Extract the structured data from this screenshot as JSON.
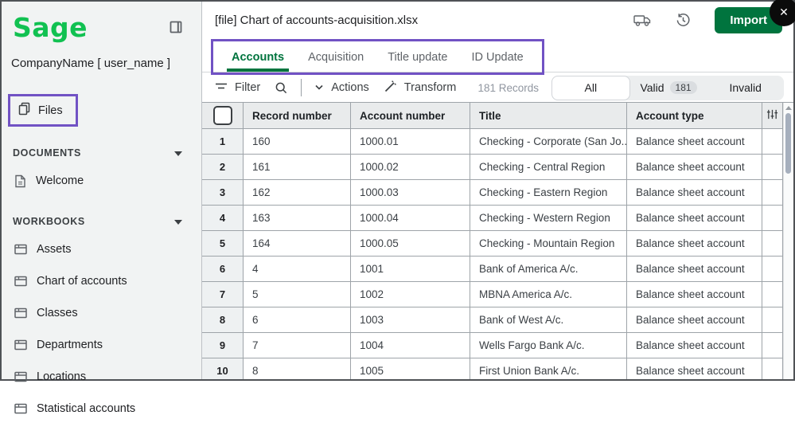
{
  "window": {
    "close_icon": "✕"
  },
  "colors": {
    "brand_green": "#11c151",
    "dark_green": "#00743e",
    "purple": "#7152c4"
  },
  "sidebar": {
    "logo_text": "Sage",
    "company": "CompanyName [ user_name ]",
    "files_label": "Files",
    "sections": [
      {
        "label": "DOCUMENTS",
        "items": [
          {
            "label": "Welcome",
            "icon": "document-icon"
          }
        ]
      },
      {
        "label": "WORKBOOKS",
        "items": [
          {
            "label": "Assets",
            "icon": "workbook-icon"
          },
          {
            "label": "Chart of accounts",
            "icon": "workbook-icon"
          },
          {
            "label": "Classes",
            "icon": "workbook-icon"
          },
          {
            "label": "Departments",
            "icon": "workbook-icon"
          },
          {
            "label": "Locations",
            "icon": "workbook-icon"
          },
          {
            "label": "Statistical accounts",
            "icon": "workbook-icon"
          }
        ]
      }
    ]
  },
  "header": {
    "title": "[file] Chart of accounts-acquisition.xlsx",
    "import_label": "Import"
  },
  "tabs": [
    {
      "label": "Accounts",
      "active": true
    },
    {
      "label": "Acquisition",
      "active": false
    },
    {
      "label": "Title update",
      "active": false
    },
    {
      "label": "ID Update",
      "active": false
    }
  ],
  "toolbar": {
    "filter_label": "Filter",
    "actions_label": "Actions",
    "transform_label": "Transform",
    "records_text": "181 Records",
    "segments": [
      {
        "label": "All",
        "active": true
      },
      {
        "label": "Valid",
        "badge": "181",
        "active": false
      },
      {
        "label": "Invalid",
        "active": false
      }
    ]
  },
  "table": {
    "columns": [
      "Record number",
      "Account number",
      "Title",
      "Account type"
    ],
    "rows": [
      {
        "index": "1",
        "record_number": "160",
        "account_number": "1000.01",
        "title": "Checking - Corporate (San Jo...",
        "account_type": "Balance sheet account"
      },
      {
        "index": "2",
        "record_number": "161",
        "account_number": "1000.02",
        "title": "Checking - Central Region",
        "account_type": "Balance sheet account"
      },
      {
        "index": "3",
        "record_number": "162",
        "account_number": "1000.03",
        "title": "Checking - Eastern Region",
        "account_type": "Balance sheet account"
      },
      {
        "index": "4",
        "record_number": "163",
        "account_number": "1000.04",
        "title": "Checking - Western Region",
        "account_type": "Balance sheet account"
      },
      {
        "index": "5",
        "record_number": "164",
        "account_number": "1000.05",
        "title": "Checking - Mountain Region",
        "account_type": "Balance sheet account"
      },
      {
        "index": "6",
        "record_number": "4",
        "account_number": "1001",
        "title": "Bank of America A/c.",
        "account_type": "Balance sheet account"
      },
      {
        "index": "7",
        "record_number": "5",
        "account_number": "1002",
        "title": "MBNA America A/c.",
        "account_type": "Balance sheet account"
      },
      {
        "index": "8",
        "record_number": "6",
        "account_number": "1003",
        "title": "Bank of West A/c.",
        "account_type": "Balance sheet account"
      },
      {
        "index": "9",
        "record_number": "7",
        "account_number": "1004",
        "title": "Wells Fargo Bank A/c.",
        "account_type": "Balance sheet account"
      },
      {
        "index": "10",
        "record_number": "8",
        "account_number": "1005",
        "title": "First Union Bank A/c.",
        "account_type": "Balance sheet account"
      }
    ]
  }
}
